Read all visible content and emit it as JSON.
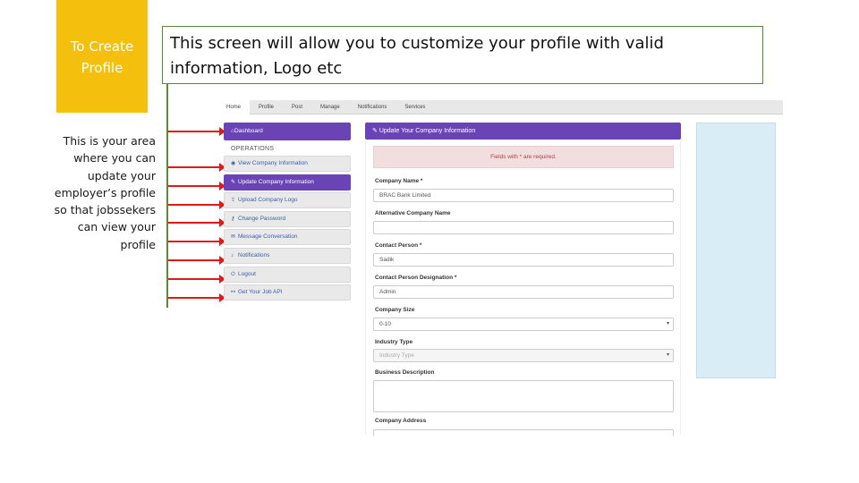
{
  "slide": {
    "title": "To Create Profile",
    "left_description": "This is your area where you can update your employer’s profile so that jobssekers can view your profile",
    "callout_text": "This screen will allow you to customize your profile with valid information, Logo etc",
    "accent_color": "#f5bf0e",
    "line_color": "#5c8a32",
    "arrow_color": "#e31818"
  },
  "app": {
    "nav": [
      "Home",
      "Profile",
      "Post",
      "Manage",
      "Notifications",
      "Services"
    ],
    "sidebar": {
      "dashboard": "Dashboard",
      "section_heading": "OPERATIONS",
      "items": [
        {
          "label": "View Company Information",
          "icon": "eye-icon"
        },
        {
          "label": "Update Company Information",
          "icon": "edit-icon"
        },
        {
          "label": "Upload Company Logo",
          "icon": "upload-icon"
        },
        {
          "label": "Change Password",
          "icon": "key-icon"
        },
        {
          "label": "Message Conversation",
          "icon": "chat-icon"
        },
        {
          "label": "Notifications",
          "icon": "bell-icon"
        },
        {
          "label": "Logout",
          "icon": "logout-icon"
        },
        {
          "label": "Get Your Job API",
          "icon": "link-icon"
        }
      ]
    },
    "form": {
      "header": "Update Your Company Information",
      "alert": "Fields with * are required.",
      "company_name_label": "Company Name *",
      "company_name_value": "BRAC Bank Limited",
      "alt_name_label": "Alternative Company Name",
      "alt_name_value": "",
      "contact_person_label": "Contact Person *",
      "contact_person_value": "Sadik",
      "designation_label": "Contact Person Designation *",
      "designation_value": "Admin",
      "company_size_label": "Company Size",
      "company_size_value": "0-10",
      "industry_label": "Industry Type",
      "industry_placeholder": "Industry Type",
      "business_label": "Business Description",
      "address_label": "Company Address"
    },
    "colors": {
      "primary": "#6a43b6",
      "alert_bg": "#f2dede",
      "side_panel": "#d9edf7"
    }
  }
}
